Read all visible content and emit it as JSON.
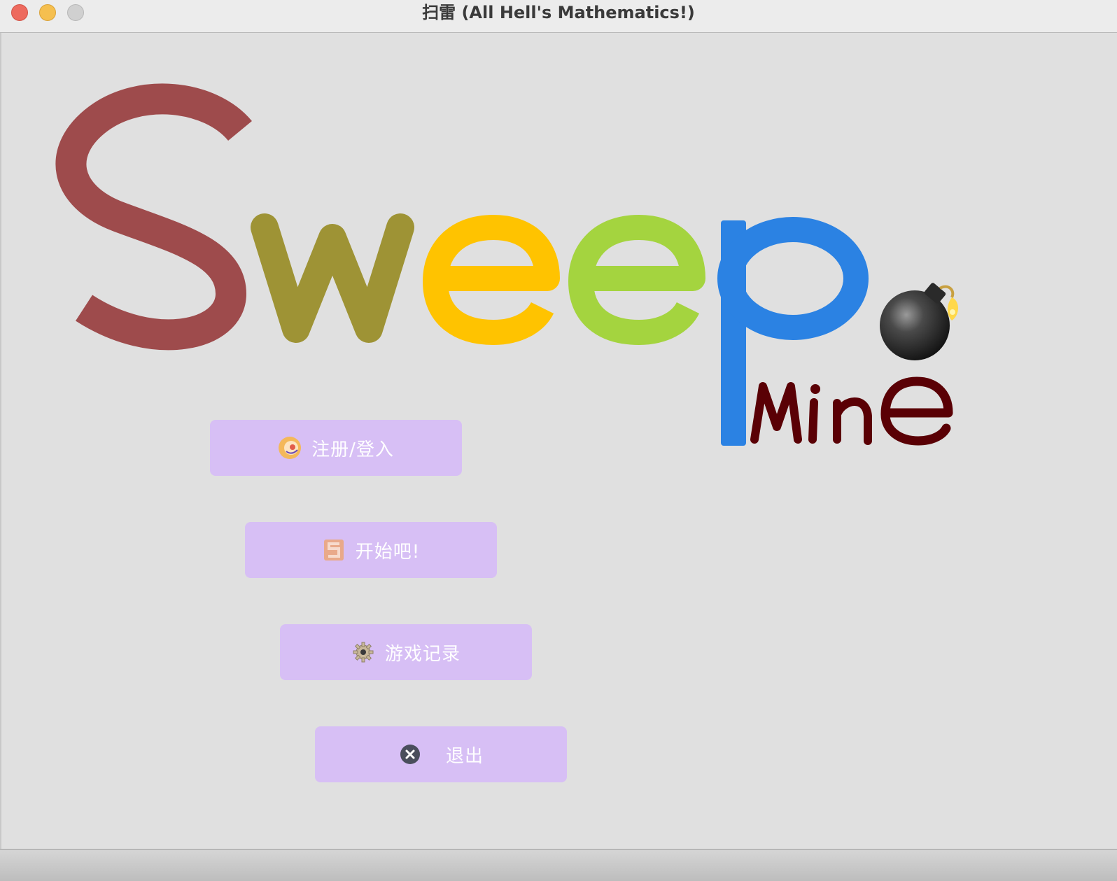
{
  "window": {
    "title": "扫雷 (All Hell's Mathematics!)"
  },
  "logo": {
    "letters": [
      "S",
      "w",
      "e",
      "e",
      "p"
    ],
    "letter_colors": [
      "#9e4b4c",
      "#9e9335",
      "#ffc300",
      "#a4d43f",
      "#2b82e3"
    ],
    "subtitle": "Mine",
    "subtitle_color": "#5a0005",
    "bomb_icon": "bomb-icon"
  },
  "menu": {
    "login": {
      "label": "注册/登入",
      "icon": "login-icon"
    },
    "start": {
      "label": "开始吧!",
      "icon": "s-logo-icon"
    },
    "history": {
      "label": "游戏记录",
      "icon": "gear-icon"
    },
    "exit": {
      "label": "退出",
      "icon": "close-circle-icon"
    }
  },
  "colors": {
    "background": "#e0e0e0",
    "button": "#d7bff5",
    "button_text": "#ffffff"
  }
}
